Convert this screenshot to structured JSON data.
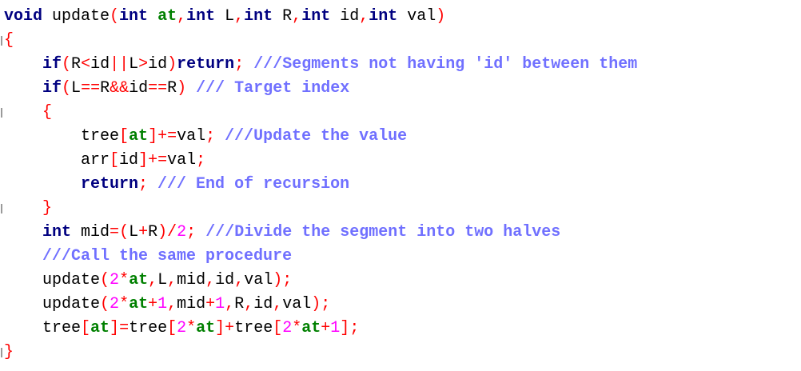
{
  "editor": {
    "lines": [
      [
        {
          "t": "void",
          "c": "kw"
        },
        {
          "t": " update",
          "c": "pl"
        },
        {
          "t": "(",
          "c": "op"
        },
        {
          "t": "int",
          "c": "kw"
        },
        {
          "t": " at",
          "c": "var"
        },
        {
          "t": ",",
          "c": "op"
        },
        {
          "t": "int",
          "c": "kw"
        },
        {
          "t": " L",
          "c": "pl"
        },
        {
          "t": ",",
          "c": "op"
        },
        {
          "t": "int",
          "c": "kw"
        },
        {
          "t": " R",
          "c": "pl"
        },
        {
          "t": ",",
          "c": "op"
        },
        {
          "t": "int",
          "c": "kw"
        },
        {
          "t": " id",
          "c": "pl"
        },
        {
          "t": ",",
          "c": "op"
        },
        {
          "t": "int",
          "c": "kw"
        },
        {
          "t": " val",
          "c": "pl"
        },
        {
          "t": ")",
          "c": "op"
        }
      ],
      [
        {
          "t": "{",
          "c": "op"
        }
      ],
      [
        {
          "t": "    ",
          "c": "pl"
        },
        {
          "t": "if",
          "c": "kw"
        },
        {
          "t": "(",
          "c": "op"
        },
        {
          "t": "R",
          "c": "pl"
        },
        {
          "t": "<",
          "c": "op"
        },
        {
          "t": "id",
          "c": "pl"
        },
        {
          "t": "||",
          "c": "op"
        },
        {
          "t": "L",
          "c": "pl"
        },
        {
          "t": ">",
          "c": "op"
        },
        {
          "t": "id",
          "c": "pl"
        },
        {
          "t": ")",
          "c": "op"
        },
        {
          "t": "return",
          "c": "kw"
        },
        {
          "t": ";",
          "c": "op"
        },
        {
          "t": " ///Segments not having 'id' between them",
          "c": "cm"
        }
      ],
      [
        {
          "t": "    ",
          "c": "pl"
        },
        {
          "t": "if",
          "c": "kw"
        },
        {
          "t": "(",
          "c": "op"
        },
        {
          "t": "L",
          "c": "pl"
        },
        {
          "t": "==",
          "c": "op"
        },
        {
          "t": "R",
          "c": "pl"
        },
        {
          "t": "&&",
          "c": "op"
        },
        {
          "t": "id",
          "c": "pl"
        },
        {
          "t": "==",
          "c": "op"
        },
        {
          "t": "R",
          "c": "pl"
        },
        {
          "t": ")",
          "c": "op"
        },
        {
          "t": " /// Target index",
          "c": "cm"
        }
      ],
      [
        {
          "t": "    ",
          "c": "pl"
        },
        {
          "t": "{",
          "c": "op"
        }
      ],
      [
        {
          "t": "        tree",
          "c": "pl"
        },
        {
          "t": "[",
          "c": "op"
        },
        {
          "t": "at",
          "c": "var"
        },
        {
          "t": "]",
          "c": "op"
        },
        {
          "t": "+=",
          "c": "op"
        },
        {
          "t": "val",
          "c": "pl"
        },
        {
          "t": ";",
          "c": "op"
        },
        {
          "t": " ///Update the value",
          "c": "cm"
        }
      ],
      [
        {
          "t": "        arr",
          "c": "pl"
        },
        {
          "t": "[",
          "c": "op"
        },
        {
          "t": "id",
          "c": "pl"
        },
        {
          "t": "]",
          "c": "op"
        },
        {
          "t": "+=",
          "c": "op"
        },
        {
          "t": "val",
          "c": "pl"
        },
        {
          "t": ";",
          "c": "op"
        }
      ],
      [
        {
          "t": "        ",
          "c": "pl"
        },
        {
          "t": "return",
          "c": "kw"
        },
        {
          "t": ";",
          "c": "op"
        },
        {
          "t": " /// End of recursion",
          "c": "cm"
        }
      ],
      [
        {
          "t": "    ",
          "c": "pl"
        },
        {
          "t": "}",
          "c": "op"
        }
      ],
      [
        {
          "t": "    ",
          "c": "pl"
        },
        {
          "t": "int",
          "c": "kw"
        },
        {
          "t": " mid",
          "c": "pl"
        },
        {
          "t": "=",
          "c": "op"
        },
        {
          "t": "(",
          "c": "op"
        },
        {
          "t": "L",
          "c": "pl"
        },
        {
          "t": "+",
          "c": "op"
        },
        {
          "t": "R",
          "c": "pl"
        },
        {
          "t": ")",
          "c": "op"
        },
        {
          "t": "/",
          "c": "op"
        },
        {
          "t": "2",
          "c": "num"
        },
        {
          "t": ";",
          "c": "op"
        },
        {
          "t": " ///Divide the segment into two halves",
          "c": "cm"
        }
      ],
      [
        {
          "t": "    ",
          "c": "pl"
        },
        {
          "t": "///Call the same procedure",
          "c": "cm"
        }
      ],
      [
        {
          "t": "    update",
          "c": "pl"
        },
        {
          "t": "(",
          "c": "op"
        },
        {
          "t": "2",
          "c": "num"
        },
        {
          "t": "*",
          "c": "op"
        },
        {
          "t": "at",
          "c": "var"
        },
        {
          "t": ",",
          "c": "op"
        },
        {
          "t": "L",
          "c": "pl"
        },
        {
          "t": ",",
          "c": "op"
        },
        {
          "t": "mid",
          "c": "pl"
        },
        {
          "t": ",",
          "c": "op"
        },
        {
          "t": "id",
          "c": "pl"
        },
        {
          "t": ",",
          "c": "op"
        },
        {
          "t": "val",
          "c": "pl"
        },
        {
          "t": ")",
          "c": "op"
        },
        {
          "t": ";",
          "c": "op"
        }
      ],
      [
        {
          "t": "    update",
          "c": "pl"
        },
        {
          "t": "(",
          "c": "op"
        },
        {
          "t": "2",
          "c": "num"
        },
        {
          "t": "*",
          "c": "op"
        },
        {
          "t": "at",
          "c": "var"
        },
        {
          "t": "+",
          "c": "op"
        },
        {
          "t": "1",
          "c": "num"
        },
        {
          "t": ",",
          "c": "op"
        },
        {
          "t": "mid",
          "c": "pl"
        },
        {
          "t": "+",
          "c": "op"
        },
        {
          "t": "1",
          "c": "num"
        },
        {
          "t": ",",
          "c": "op"
        },
        {
          "t": "R",
          "c": "pl"
        },
        {
          "t": ",",
          "c": "op"
        },
        {
          "t": "id",
          "c": "pl"
        },
        {
          "t": ",",
          "c": "op"
        },
        {
          "t": "val",
          "c": "pl"
        },
        {
          "t": ")",
          "c": "op"
        },
        {
          "t": ";",
          "c": "op"
        }
      ],
      [
        {
          "t": "    tree",
          "c": "pl"
        },
        {
          "t": "[",
          "c": "op"
        },
        {
          "t": "at",
          "c": "var"
        },
        {
          "t": "]",
          "c": "op"
        },
        {
          "t": "=",
          "c": "op"
        },
        {
          "t": "tree",
          "c": "pl"
        },
        {
          "t": "[",
          "c": "op"
        },
        {
          "t": "2",
          "c": "num"
        },
        {
          "t": "*",
          "c": "op"
        },
        {
          "t": "at",
          "c": "var"
        },
        {
          "t": "]",
          "c": "op"
        },
        {
          "t": "+",
          "c": "op"
        },
        {
          "t": "tree",
          "c": "pl"
        },
        {
          "t": "[",
          "c": "op"
        },
        {
          "t": "2",
          "c": "num"
        },
        {
          "t": "*",
          "c": "op"
        },
        {
          "t": "at",
          "c": "var"
        },
        {
          "t": "+",
          "c": "op"
        },
        {
          "t": "1",
          "c": "num"
        },
        {
          "t": "]",
          "c": "op"
        },
        {
          "t": ";",
          "c": "op"
        }
      ],
      [
        {
          "t": "}",
          "c": "op"
        }
      ]
    ]
  },
  "colors": {
    "keyword": "#000080",
    "operator": "#ff0000",
    "comment": "#7070ff",
    "number": "#ff00ff",
    "identifier_highlight": "#008000",
    "text": "#000000",
    "background": "#ffffff"
  }
}
